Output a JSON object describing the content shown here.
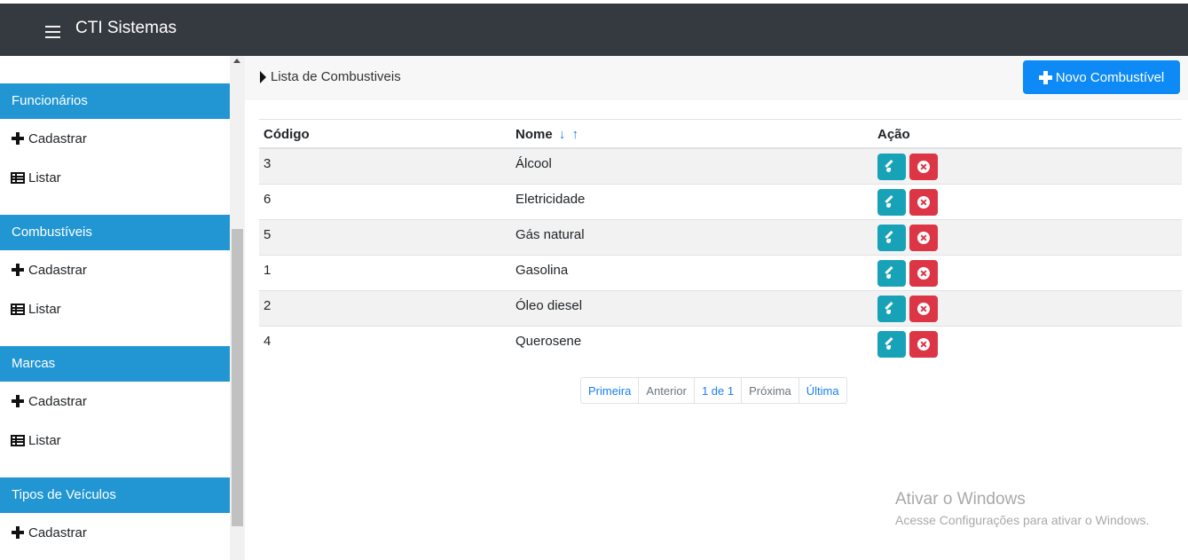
{
  "app": {
    "title": "CTI Sistemas"
  },
  "sidebar": {
    "sections": [
      {
        "title": "Funcionários",
        "items": [
          "Cadastrar",
          "Listar"
        ]
      },
      {
        "title": "Combustíveis",
        "items": [
          "Cadastrar",
          "Listar"
        ]
      },
      {
        "title": "Marcas",
        "items": [
          "Cadastrar",
          "Listar"
        ]
      },
      {
        "title": "Tipos de Veículos",
        "items": [
          "Cadastrar"
        ]
      }
    ]
  },
  "main": {
    "list_title": "Lista de Combustiveis",
    "new_button": "Novo Combustível",
    "table": {
      "headers": {
        "code": "Código",
        "name": "Nome",
        "action": "Ação"
      },
      "sort_down": "↓",
      "sort_up": "↑",
      "rows": [
        {
          "code": "3",
          "name": "Álcool"
        },
        {
          "code": "6",
          "name": "Eletricidade"
        },
        {
          "code": "5",
          "name": "Gás natural"
        },
        {
          "code": "1",
          "name": "Gasolina"
        },
        {
          "code": "2",
          "name": "Óleo diesel"
        },
        {
          "code": "4",
          "name": "Querosene"
        }
      ]
    },
    "pagination": {
      "first": "Primeira",
      "prev": "Anterior",
      "current": "1 de 1",
      "next": "Próxima",
      "last": "Última"
    }
  },
  "watermark": {
    "title": "Ativar o Windows",
    "subtitle": "Acesse Configurações para ativar o Windows."
  },
  "colors": {
    "topbar": "#343a40",
    "section_head": "#2196d3",
    "primary": "#0d8af5",
    "edit": "#17a2b8",
    "delete": "#dc3545"
  }
}
